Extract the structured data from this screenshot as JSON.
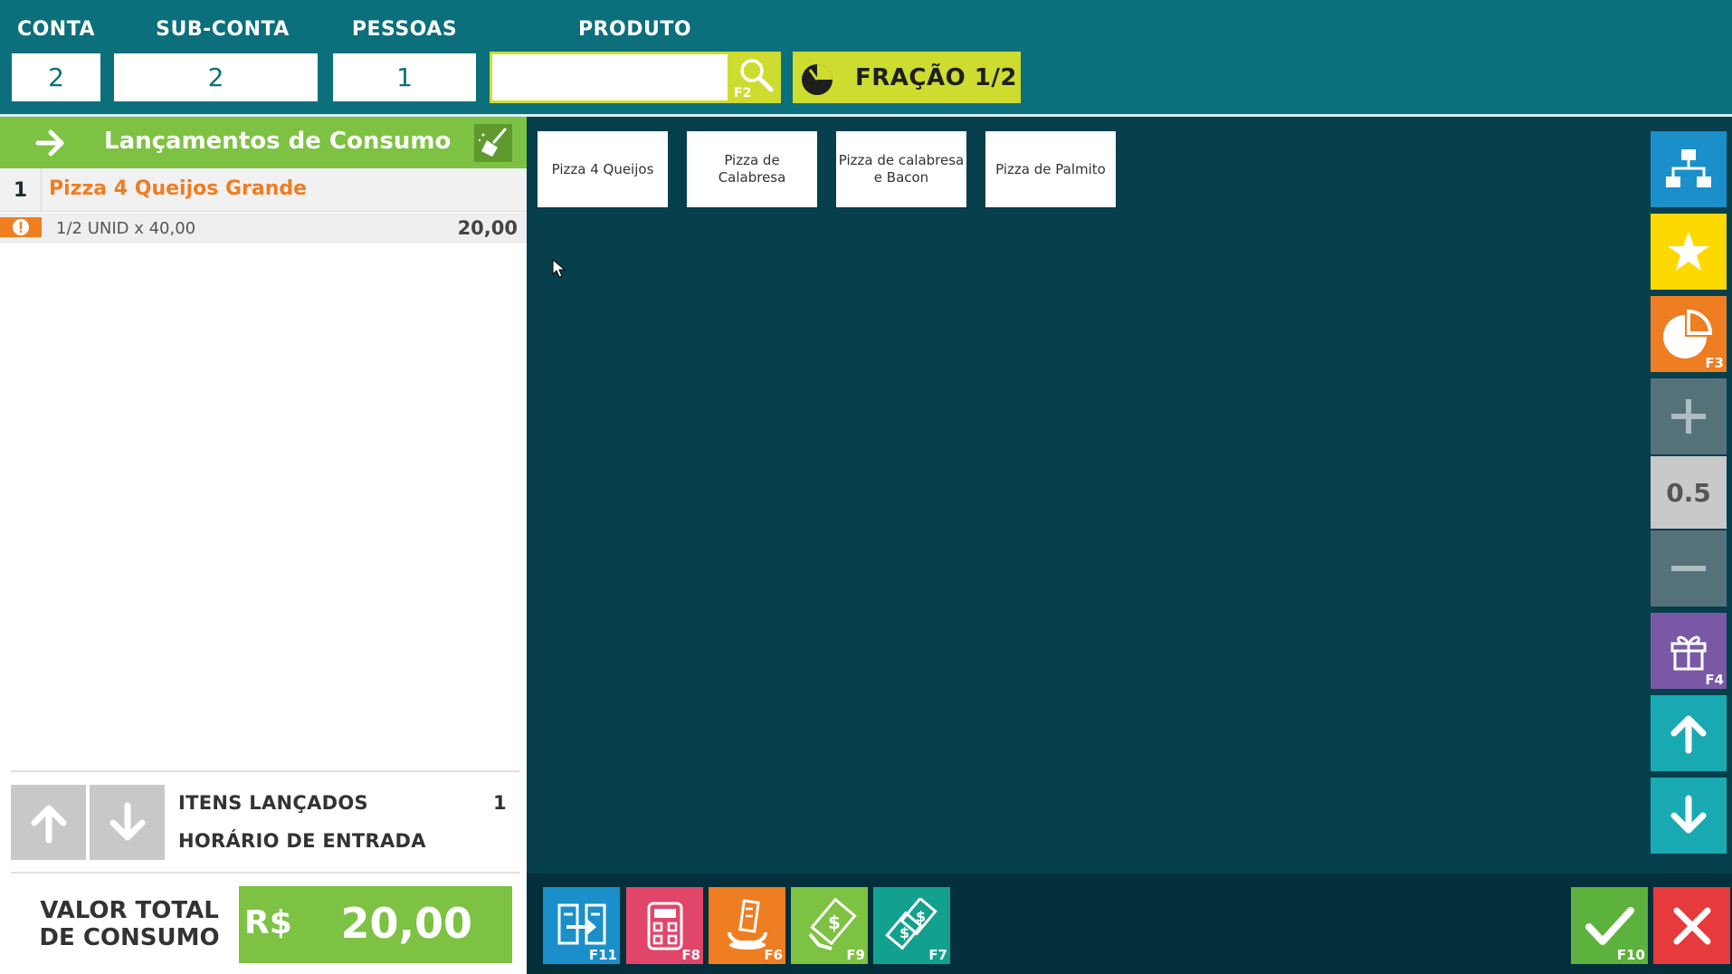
{
  "header": {
    "conta_label": "CONTA",
    "conta_value": "2",
    "subconta_label": "SUB-CONTA",
    "subconta_value": "2",
    "pessoas_label": "PESSOAS",
    "pessoas_value": "1",
    "produto_label": "PRODUTO",
    "produto_value": "",
    "search_key": "F2",
    "fracao_label": "FRAÇÃO 1/2"
  },
  "left_panel": {
    "title": "Lançamentos de Consumo",
    "items": [
      {
        "number": "1",
        "name": "Pizza 4 Queijos Grande",
        "detail": "1/2 UNID x 40,00",
        "price": "20,00"
      }
    ],
    "stats": {
      "itens_label": "ITENS LANÇADOS",
      "itens_value": "1",
      "horario_label": "HORÁRIO DE ENTRADA",
      "horario_value": ""
    },
    "total": {
      "label_line1": "VALOR TOTAL",
      "label_line2": "DE CONSUMO",
      "currency": "R$",
      "value": "20,00"
    }
  },
  "products": [
    {
      "name": "Pizza 4 Queijos"
    },
    {
      "name": "Pizza de Calabresa"
    },
    {
      "name": "Pizza de calabresa e Bacon"
    },
    {
      "name": "Pizza de Palmito"
    }
  ],
  "right_buttons": {
    "pie_key": "F3",
    "quantity": "0.5",
    "gift_key": "F4"
  },
  "bottom_buttons": {
    "transfer_key": "F11",
    "calc_key": "F8",
    "service_key": "F6",
    "pay_key": "F9",
    "multi_pay_key": "F7",
    "confirm_key": "F10"
  },
  "colors": {
    "header_bg": "#0b6f7c",
    "main_bg": "#073f4c",
    "green": "#7dc242",
    "orange": "#ef7d22",
    "yellow": "#cddc2f",
    "blue": "#1a8fc9",
    "teal": "#19a9b3",
    "pink": "#e2456a",
    "purple": "#7b58a6",
    "red": "#e63a3c"
  }
}
